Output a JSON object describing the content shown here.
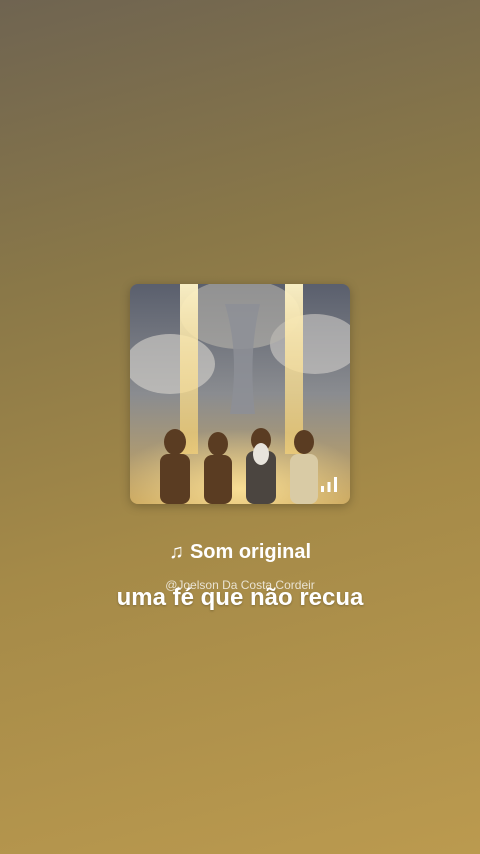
{
  "sound": {
    "title": "Som original",
    "author": "@Joelson Da Costa Cordeir"
  },
  "caption": {
    "text": "uma fé que não recua"
  },
  "icons": {
    "music_note": "music-note-icon",
    "playing_bars": "playing-bars-icon"
  },
  "colors": {
    "background_top": "#6f6451",
    "background_bottom": "#bb9a4f",
    "text": "#ffffff"
  }
}
